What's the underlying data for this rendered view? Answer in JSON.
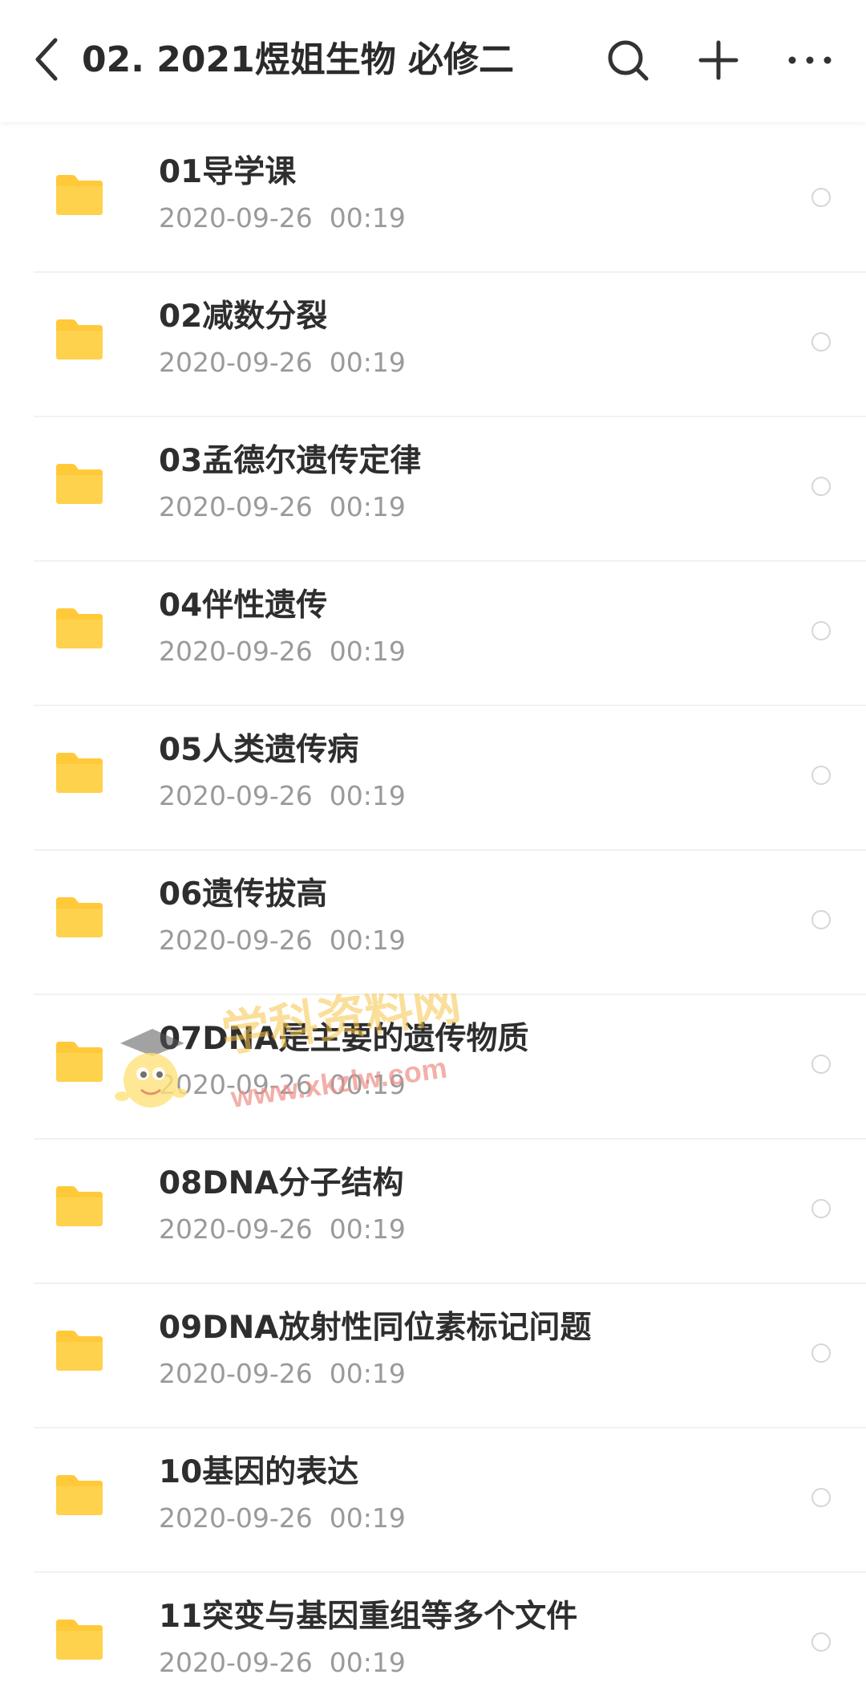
{
  "header": {
    "title": "02. 2021煜姐生物 必修二",
    "back_icon": "chevron-left-icon",
    "search_icon": "search-icon",
    "add_icon": "plus-icon",
    "more_icon": "more-horizontal-icon"
  },
  "colors": {
    "folder": "#FFC93A",
    "title_text": "#2B2B2B",
    "meta_text": "#9A9A9A",
    "divider": "#F1F1F1"
  },
  "files": [
    {
      "name": "01导学课",
      "date": "2020-09-26  00:19"
    },
    {
      "name": "02减数分裂",
      "date": "2020-09-26  00:19"
    },
    {
      "name": "03孟德尔遗传定律",
      "date": "2020-09-26  00:19"
    },
    {
      "name": "04伴性遗传",
      "date": "2020-09-26  00:19"
    },
    {
      "name": "05人类遗传病",
      "date": "2020-09-26  00:19"
    },
    {
      "name": "06遗传拔高",
      "date": "2020-09-26  00:19"
    },
    {
      "name": "07DNA是主要的遗传物质",
      "date": "2020-09-26  00:19"
    },
    {
      "name": "08DNA分子结构",
      "date": "2020-09-26  00:19"
    },
    {
      "name": "09DNA放射性同位素标记问题",
      "date": "2020-09-26  00:19"
    },
    {
      "name": "10基因的表达",
      "date": "2020-09-26  00:19"
    },
    {
      "name": "11突变与基因重组等多个文件",
      "date": "2020-09-26  00:19"
    }
  ],
  "watermark": {
    "brand": "学科资料网",
    "url": "www.xkzlw.com"
  }
}
